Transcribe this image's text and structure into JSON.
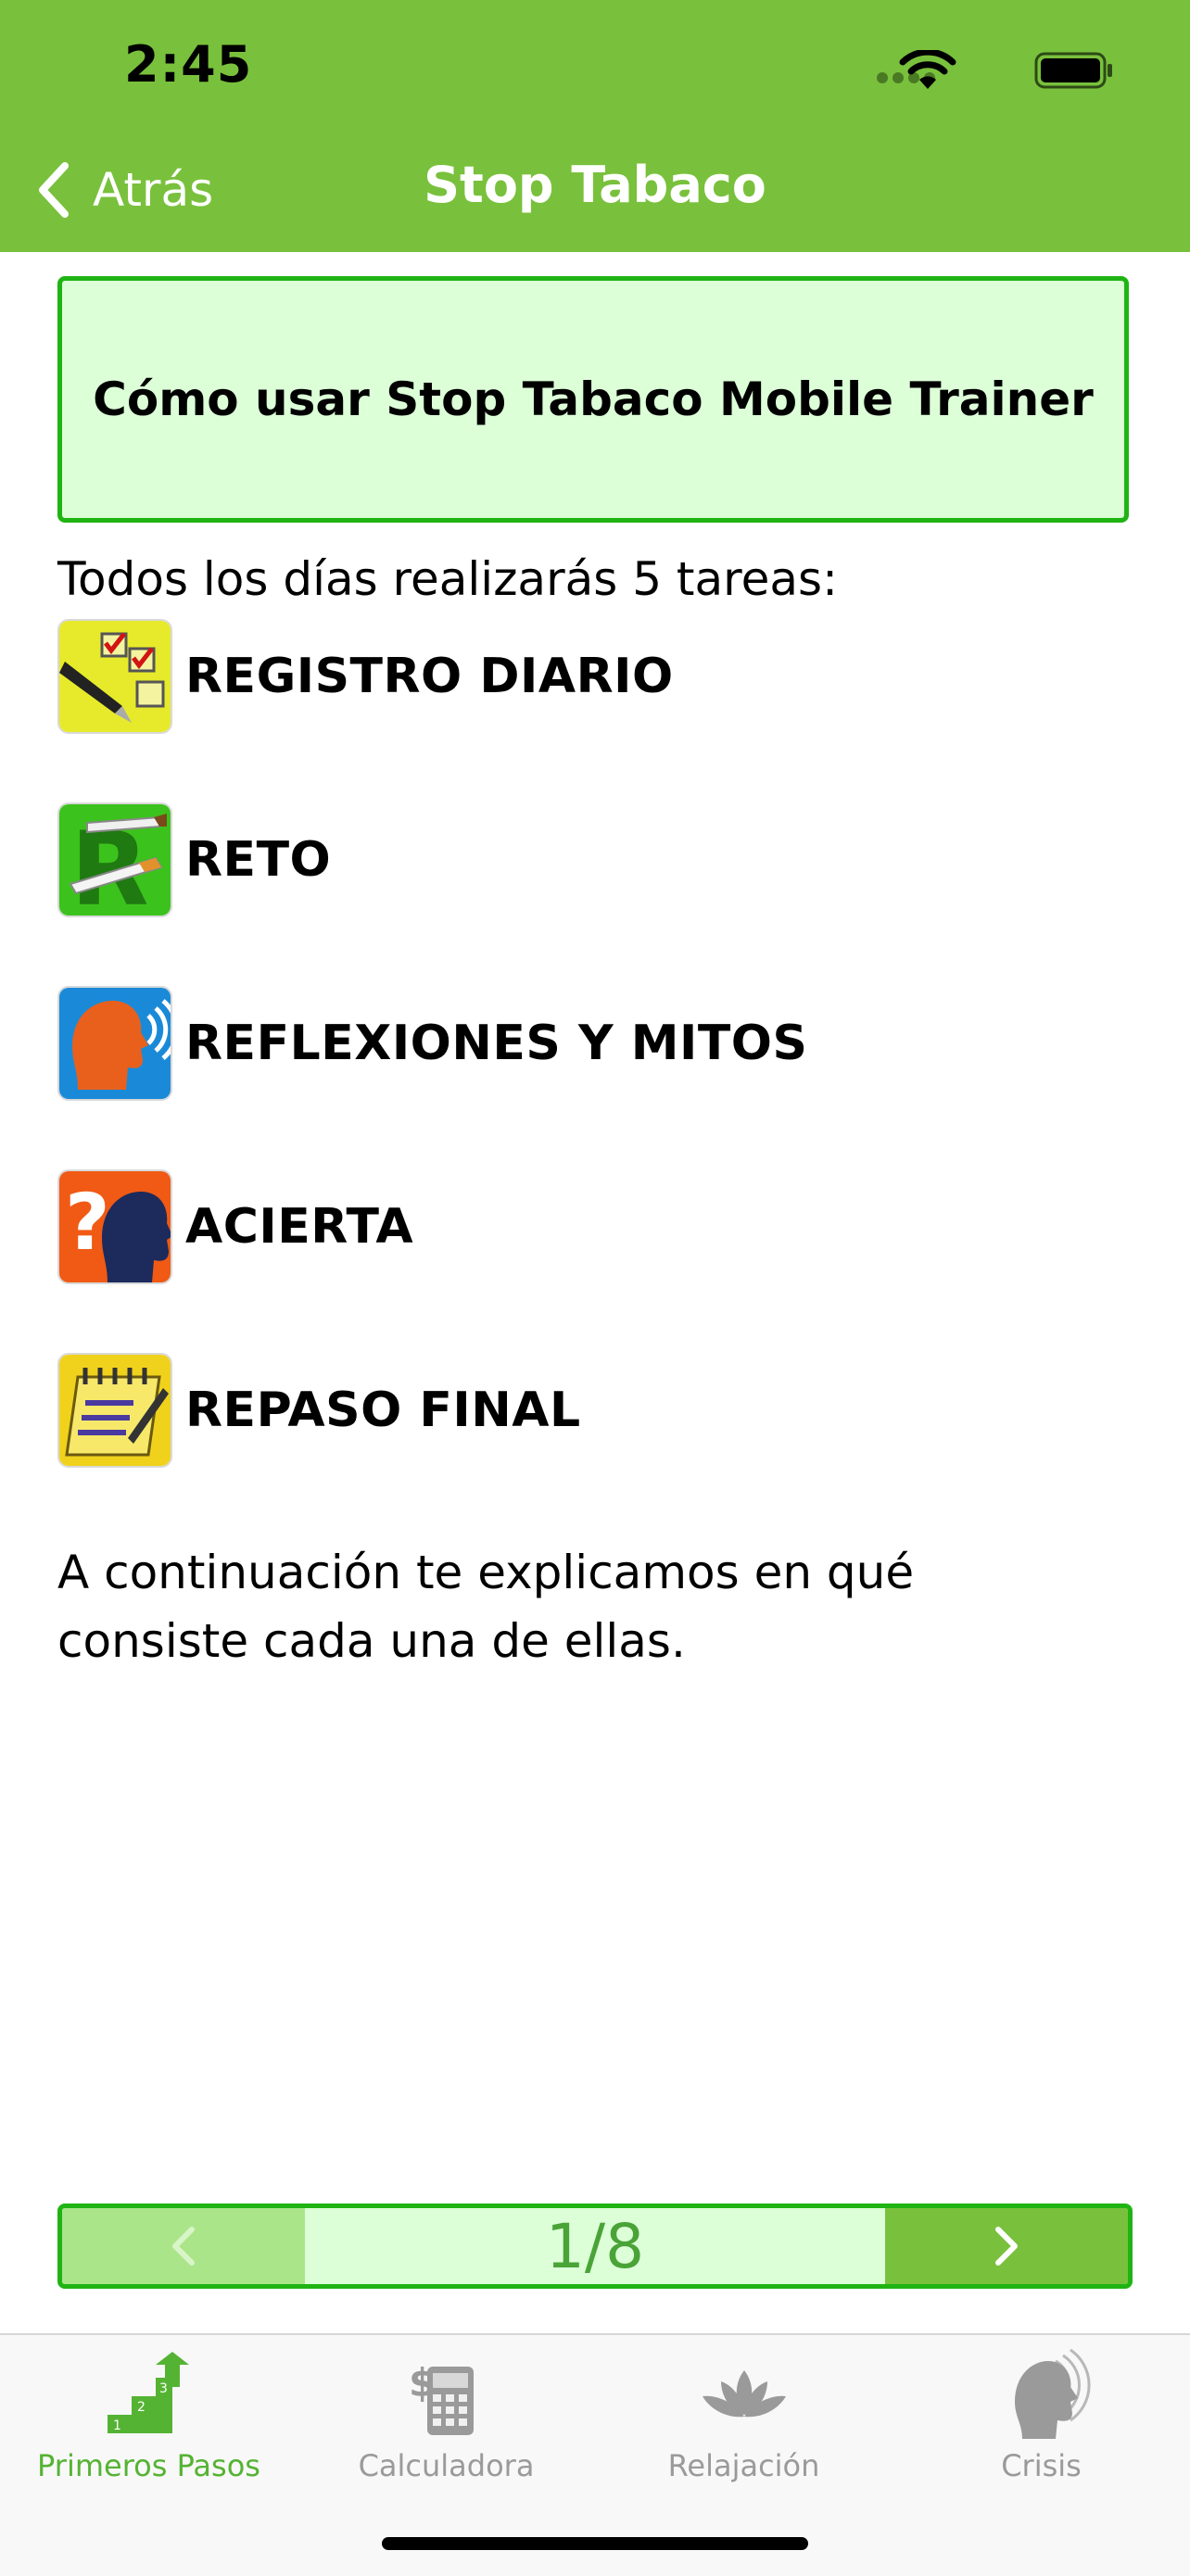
{
  "status_bar": {
    "time": "2:45"
  },
  "nav": {
    "back_label": "Atrás",
    "title": "Stop Tabaco"
  },
  "how_box": {
    "title": "Cómo usar Stop Tabaco Mobile Trainer"
  },
  "intro": "Todos los días realizarás 5 tareas:",
  "tasks": [
    {
      "label": "REGISTRO DIARIO",
      "icon": "checklist-pen-icon"
    },
    {
      "label": "RETO",
      "icon": "cigarette-r-icon"
    },
    {
      "label": "REFLEXIONES Y MITOS",
      "icon": "speaking-head-icon"
    },
    {
      "label": "ACIERTA",
      "icon": "question-head-icon"
    },
    {
      "label": "REPASO FINAL",
      "icon": "notepad-icon"
    }
  ],
  "outro": "A continuación te explicamos en qué consiste cada una de ellas.",
  "pager": {
    "indicator": "1/8"
  },
  "tabbar": {
    "items": [
      {
        "label": "Primeros Pasos",
        "icon": "stairs-arrow-icon",
        "active": true
      },
      {
        "label": "Calculadora",
        "icon": "calculator-dollar-icon",
        "active": false
      },
      {
        "label": "Relajación",
        "icon": "lotus-icon",
        "active": false
      },
      {
        "label": "Crisis",
        "icon": "head-waves-icon",
        "active": false
      }
    ]
  },
  "colors": {
    "header_green": "#79c13c",
    "box_fill": "#dcffd8",
    "box_border": "#1fb413",
    "active_tab": "#55b333"
  }
}
